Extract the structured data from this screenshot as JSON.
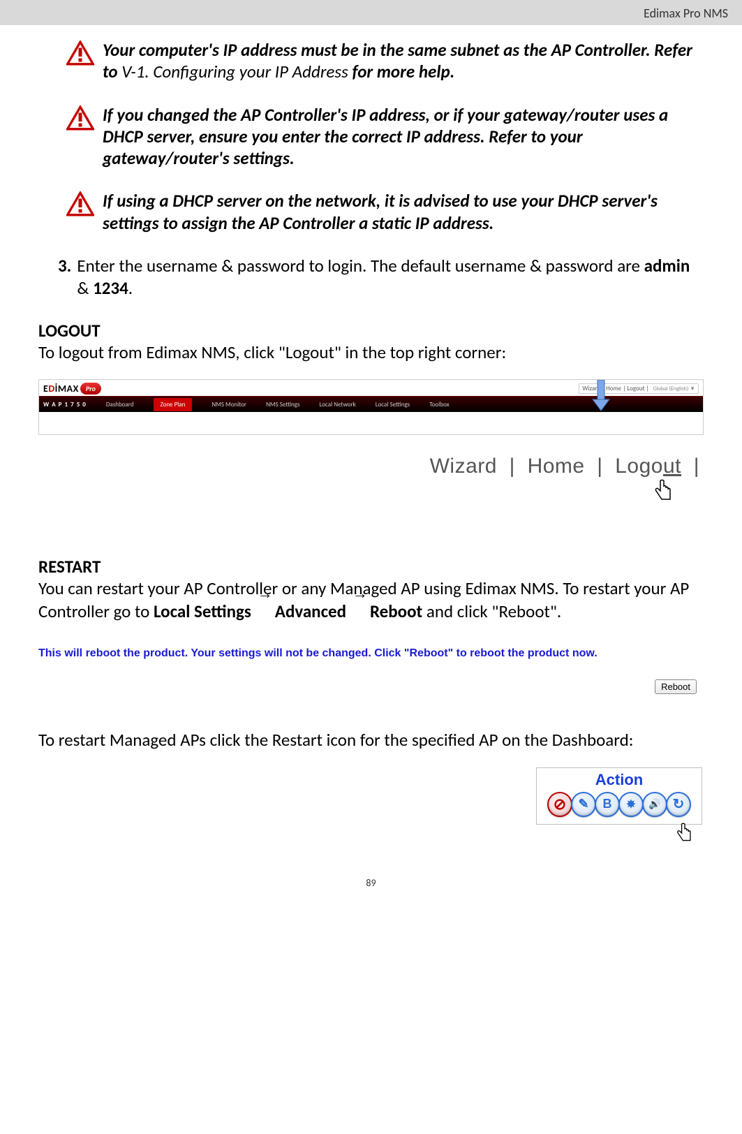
{
  "header": {
    "title": "Edimax Pro NMS"
  },
  "warnings": [
    {
      "text": "Your computer's IP address must be in the same subnet as the AP Controller. Refer to V-1. Configuring your IP Address for more help."
    },
    {
      "text": "If you changed the AP Controller's IP address, or if your gateway/router uses a DHCP server, ensure you enter the correct IP address. Refer to your gateway/router's settings."
    },
    {
      "text": "If using a DHCP server on the network, it is advised to use your DHCP server's settings to assign the AP Controller a static IP address."
    }
  ],
  "step": {
    "num": "3.",
    "text_pre": "Enter the username & password to login. The default username & password are ",
    "bold1": "admin",
    "mid": " & ",
    "bold2": "1234",
    "post": "."
  },
  "logout": {
    "head": "LOGOUT",
    "text": "To logout from Edimax NMS, click \"Logout\" in the top right corner:"
  },
  "screenshot": {
    "logo_text": "EDIMAX",
    "pro": "Pro",
    "toplinks": "Wizard | Home | Logout |",
    "lang": "Global (English) ▼",
    "nav": {
      "model": "W A P 1 7 5 0",
      "items": [
        "Dashboard",
        "Zone Plan",
        "NMS Monitor",
        "NMS Settings",
        "Local Network",
        "Local Settings",
        "Toolbox"
      ],
      "active_index": 1
    }
  },
  "zoom_links": "Wizard  |  Home  |  Logout  |",
  "restart": {
    "head": "RESTART",
    "t1": "You can restart your AP Controller or any Managed AP using Edimax NMS. To restart your AP Controller go to ",
    "b1": "Local Settings",
    "arr": "→",
    "b2": "Advanced",
    "b3": "Reboot",
    "t2": " and click \"Reboot\"."
  },
  "reboot_note": "This will reboot the product. Your settings will not be changed. Click \"Reboot\" to reboot the product now.",
  "reboot_btn": "Reboot",
  "restart_ap_text": "To restart Managed APs click the Restart icon for the specified AP on the Dashboard:",
  "action": {
    "title": "Action",
    "icons": [
      {
        "name": "disable-icon",
        "sym": "⊘",
        "border": "#b00",
        "fg": "#b00",
        "bg": "#f8dede"
      },
      {
        "name": "edit-icon",
        "sym": "✎",
        "border": "#2a6fd6",
        "fg": "#2a6fd6",
        "bg": "#e2edfb"
      },
      {
        "name": "b-icon",
        "sym": "B",
        "border": "#2a6fd6",
        "fg": "#2a6fd6",
        "bg": "#e2edfb"
      },
      {
        "name": "blink-icon",
        "sym": "✦",
        "border": "#2a6fd6",
        "fg": "#2a6fd6",
        "bg": "#e2edfb"
      },
      {
        "name": "buzzer-icon",
        "sym": "🔊",
        "border": "#2a6fd6",
        "fg": "#2a6fd6",
        "bg": "#e2edfb"
      },
      {
        "name": "restart-icon",
        "sym": "↻",
        "border": "#2a6fd6",
        "fg": "#2a6fd6",
        "bg": "#e2edfb"
      }
    ]
  },
  "page_num": "89"
}
